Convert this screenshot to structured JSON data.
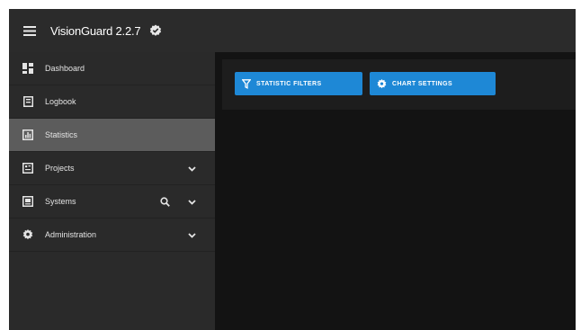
{
  "header": {
    "title": "VisionGuard 2.2.7",
    "menu_icon": "hamburger-menu-icon",
    "badge_icon": "verified-check-icon"
  },
  "sidebar": {
    "items": [
      {
        "label": "Dashboard",
        "icon": "dashboard-icon",
        "active": false
      },
      {
        "label": "Logbook",
        "icon": "logbook-icon",
        "active": false
      },
      {
        "label": "Statistics",
        "icon": "chart-icon",
        "active": true
      },
      {
        "label": "Projects",
        "icon": "projects-icon",
        "active": false,
        "expandable": true
      },
      {
        "label": "Systems",
        "icon": "systems-icon",
        "active": false,
        "expandable": true,
        "searchable": true
      },
      {
        "label": "Administration",
        "icon": "gear-icon",
        "active": false,
        "expandable": true
      }
    ]
  },
  "toolbar": {
    "filters_label": "STATISTIC FILTERS",
    "chart_settings_label": "CHART SETTINGS"
  },
  "colors": {
    "accent": "#1e88d6",
    "topbar": "#2b2b2b",
    "sidebar": "#2a2a2a",
    "sidebar_active": "#5c5c5c",
    "content": "#131313",
    "toolbar": "#1d1d1d"
  }
}
